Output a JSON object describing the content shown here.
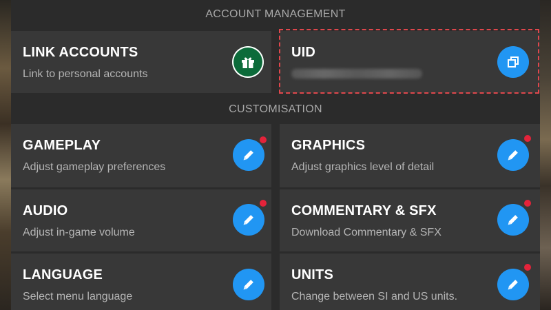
{
  "sections": {
    "account": {
      "header": "ACCOUNT MANAGEMENT",
      "link_accounts": {
        "title": "LINK ACCOUNTS",
        "subtitle": "Link to personal accounts",
        "icon": "gift-icon"
      },
      "uid": {
        "title": "UID",
        "value_hidden": true,
        "icon": "copy-icon"
      }
    },
    "customisation": {
      "header": "CUSTOMISATION",
      "gameplay": {
        "title": "GAMEPLAY",
        "subtitle": "Adjust gameplay preferences",
        "icon": "pencil-icon",
        "badge": true
      },
      "graphics": {
        "title": "GRAPHICS",
        "subtitle": "Adjust graphics level of detail",
        "icon": "pencil-icon",
        "badge": true
      },
      "audio": {
        "title": "AUDIO",
        "subtitle": "Adjust in-game volume",
        "icon": "pencil-icon",
        "badge": true
      },
      "commentary": {
        "title": "COMMENTARY & SFX",
        "subtitle": "Download Commentary & SFX",
        "icon": "pencil-icon",
        "badge": true
      },
      "language": {
        "title": "LANGUAGE",
        "subtitle": "Select menu language",
        "icon": "pencil-icon",
        "badge": false
      },
      "units": {
        "title": "UNITS",
        "subtitle": "Change between SI and US units.",
        "icon": "pencil-icon",
        "badge": true
      }
    }
  },
  "colors": {
    "panel": "#2b2b2b",
    "card": "#383838",
    "accent_blue": "#2196f3",
    "gift_green": "#0c6b3a",
    "badge_red": "#e4233a",
    "highlight_red": "#e0474c"
  }
}
